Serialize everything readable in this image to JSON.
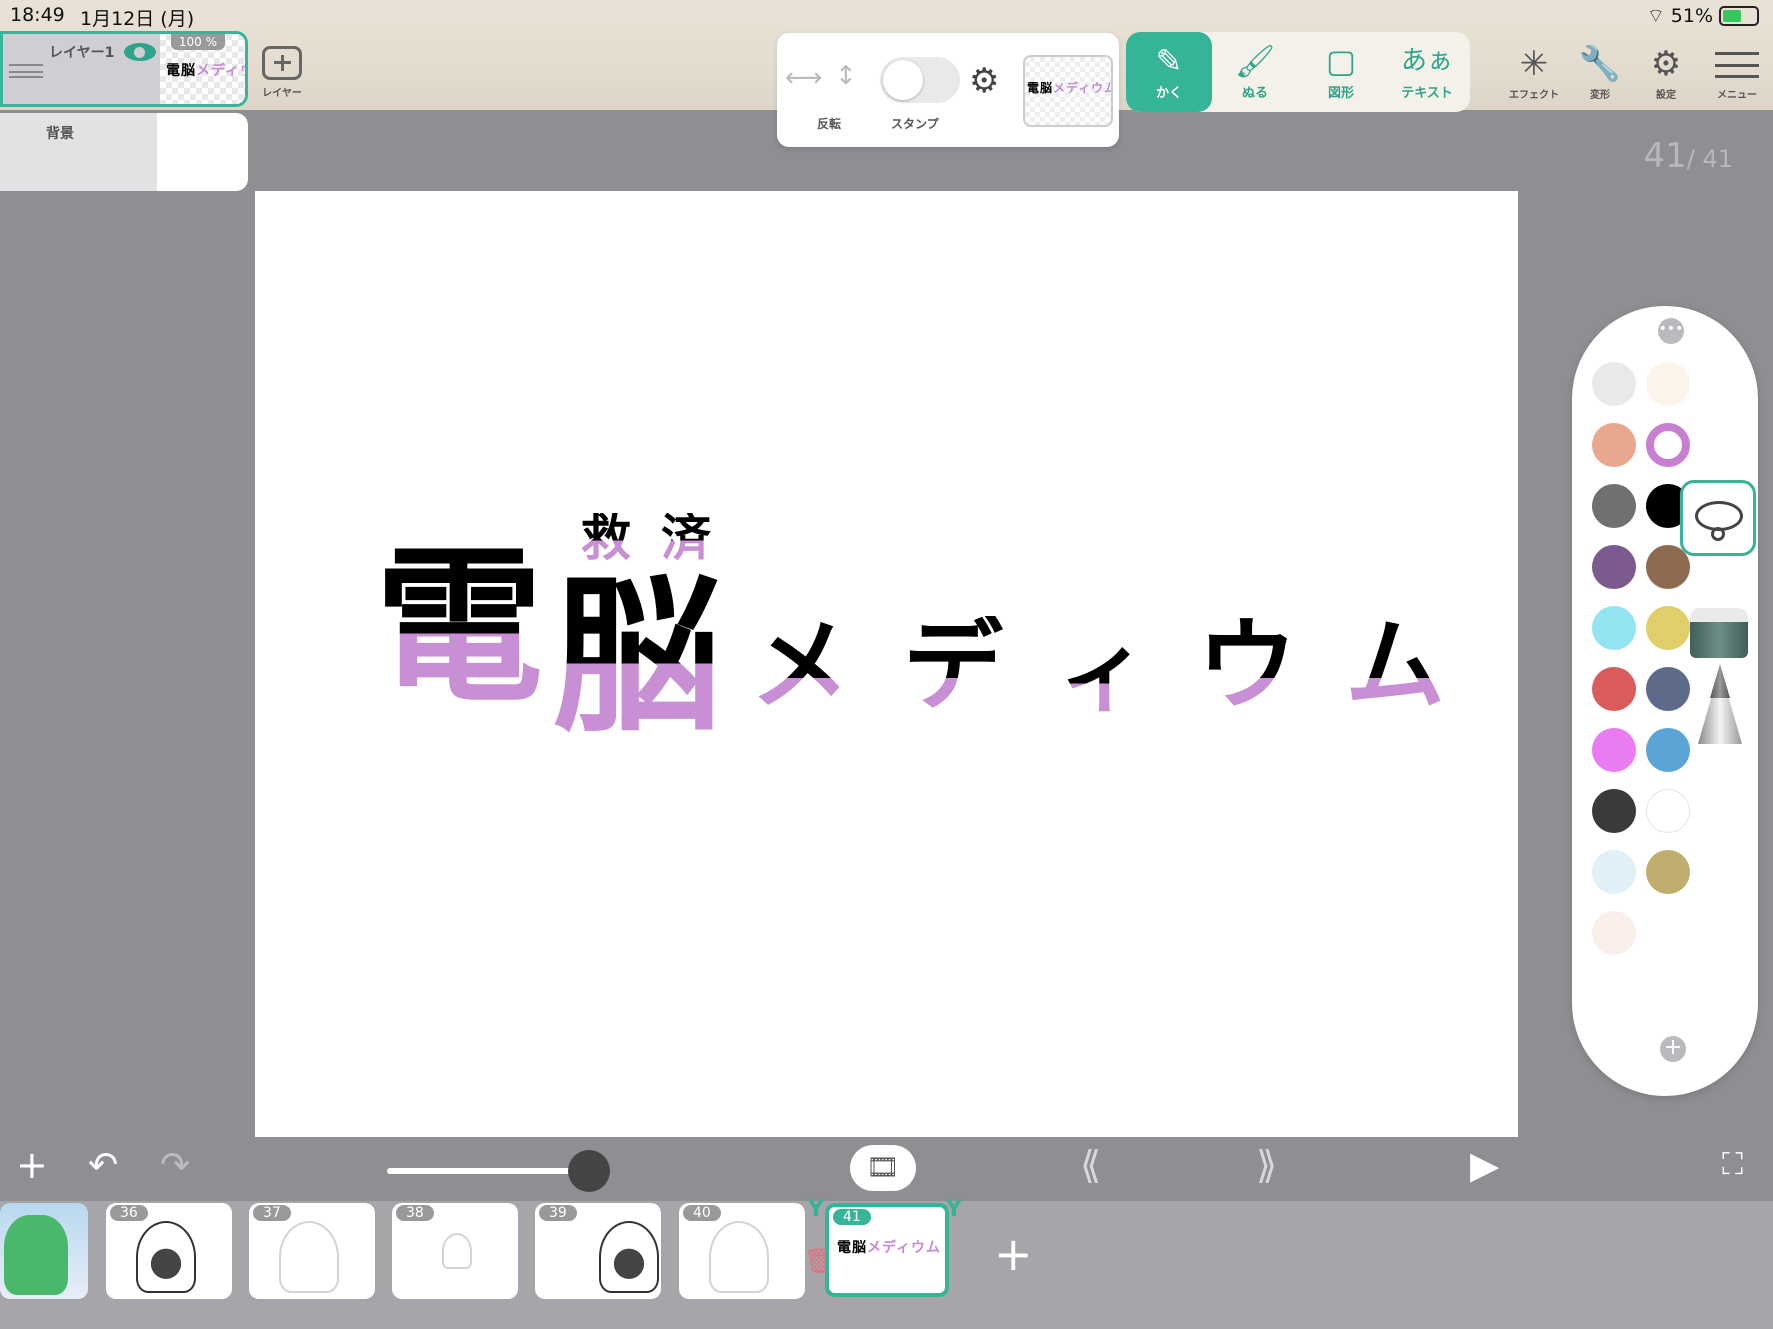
{
  "status": {
    "time": "18:49",
    "date": "1月12日 (月)",
    "battery": "51%"
  },
  "layers": [
    {
      "name": "レイヤー1",
      "opacity": "100 %",
      "visible": true,
      "active": true
    },
    {
      "name": "背景",
      "active": false
    }
  ],
  "layer_add_label": "レイヤー",
  "pen_options": {
    "flip_label": "反転",
    "stamp_label": "スタンプ",
    "stamp_on": false
  },
  "thumb_text": {
    "black": "電脳",
    "pink": "メディウム"
  },
  "tools": [
    {
      "label": "かく",
      "icon": "pencil-icon",
      "glyph": "✎",
      "active": true
    },
    {
      "label": "ぬる",
      "icon": "brush-icon",
      "glyph": "🖌",
      "active": false
    },
    {
      "label": "図形",
      "icon": "shape-icon",
      "glyph": "▢",
      "active": false
    },
    {
      "label": "テキスト",
      "icon": "text-icon",
      "glyph": "あぁ",
      "active": false
    }
  ],
  "right_icons": {
    "effect": "エフェクト",
    "transform": "変形",
    "settings": "設定",
    "menu": "メニュー"
  },
  "page": {
    "current": "41",
    "total": "/ 41"
  },
  "artwork": {
    "ruby": [
      "救",
      "済"
    ],
    "main": [
      "電",
      "脳"
    ],
    "kana": [
      "メ",
      "デ",
      "ィ",
      "ウ",
      "ム"
    ],
    "colors": {
      "ink": "#000000",
      "pink": "#c98fd4"
    }
  },
  "palette": {
    "colors": [
      "#ebe9e8",
      "#fbf4ea",
      "#e9a78e",
      "#c77fd0",
      "#707072",
      "#000000",
      "#7a5a8f",
      "#8d6a50",
      "#93e4f1",
      "#e0cf6a",
      "#d95b5b",
      "#5d6a8a",
      "#ea7cf1",
      "#5aa5d6",
      "#3a3a3a",
      "#ffffff",
      "#dff0f6",
      "#bfae6e",
      "#fbefec"
    ],
    "selected": "#c77fd0"
  },
  "frames": [
    {
      "num": "",
      "kind": "color"
    },
    {
      "num": "36",
      "kind": "dark"
    },
    {
      "num": "37",
      "kind": "light"
    },
    {
      "num": "38",
      "kind": "light"
    },
    {
      "num": "39",
      "kind": "dark"
    },
    {
      "num": "40",
      "kind": "light"
    },
    {
      "num": "41",
      "kind": "active"
    }
  ],
  "accent": "#36b497"
}
